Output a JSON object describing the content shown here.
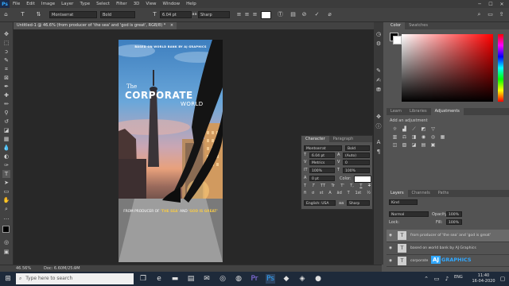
{
  "app": {
    "logo": "Ps",
    "menu": [
      "File",
      "Edit",
      "Image",
      "Layer",
      "Type",
      "Select",
      "Filter",
      "3D",
      "View",
      "Window",
      "Help"
    ],
    "window_controls": [
      "─",
      "☐",
      "✕"
    ]
  },
  "options_bar": {
    "font_family": "Montserrat",
    "font_style": "Bold",
    "font_size": "6.04 pt",
    "antialias": "Sharp"
  },
  "document_tab": {
    "title": "Untitled-1 @ 46.6% (from producer of 'the sea' and 'god is great', RGB/8) *",
    "close": "×"
  },
  "poster": {
    "top_line": "BASED ON WORLD BANK BY AJ GRAPHICS",
    "the": "The",
    "title": "CORPORATE",
    "subtitle": "WORLD",
    "tagline_prefix": "FROM PRODUCER OF",
    "tagline_quote1": "'THE SEA'",
    "tagline_and": "AND",
    "tagline_quote2": "'GOD IS GREAT'"
  },
  "status_bar": {
    "zoom": "46.56%",
    "doc": "Doc: 6.60M/25.9M"
  },
  "color_panel": {
    "tabs": [
      "Color",
      "Swatches"
    ]
  },
  "adjustments_panel": {
    "tabs": [
      "Learn",
      "Libraries",
      "Adjustments"
    ],
    "hint": "Add an adjustment"
  },
  "character_panel": {
    "tabs": [
      "Character",
      "Paragraph"
    ],
    "font_family": "Montserrat",
    "font_style": "Bold",
    "font_size": "6.04 pt",
    "leading": "(Auto)",
    "kerning": "Metrics",
    "tracking": "0",
    "vscale": "100%",
    "hscale": "100%",
    "baseline": "0 pt",
    "color_label": "Color:",
    "language": "English: USA",
    "aa_label": "aa",
    "antialias": "Sharp",
    "style_buttons": [
      "T",
      "T",
      "TT",
      "Tr",
      "T'",
      "T,",
      "T",
      "T"
    ],
    "opentype_buttons": [
      "fi",
      "ơ",
      "st",
      "A",
      "ād",
      "T",
      "1st",
      "½"
    ]
  },
  "layers_panel": {
    "tabs": [
      "Layers",
      "Channels",
      "Paths"
    ],
    "kind": "Kind",
    "blend_mode": "Normal",
    "opacity_label": "Opacity:",
    "opacity": "100%",
    "lock_label": "Lock:",
    "fill_label": "Fill:",
    "fill": "100%",
    "layers": [
      {
        "name": "from producer of 'the sea' and 'god is great'",
        "thumb": "T"
      },
      {
        "name": "based on world bank by AJ Graphics",
        "thumb": "T"
      },
      {
        "name": "corporate",
        "thumb": "T"
      }
    ]
  },
  "watermark": {
    "aj": "AJ",
    "graphics": "GRAPHICS"
  },
  "taskbar": {
    "search_placeholder": "Type here to search",
    "language": "ENG",
    "time": "11:40",
    "date": "16-04-2020"
  },
  "colors": {
    "accent": "#31a8ff",
    "tagline_gold": "#f2c84b"
  }
}
